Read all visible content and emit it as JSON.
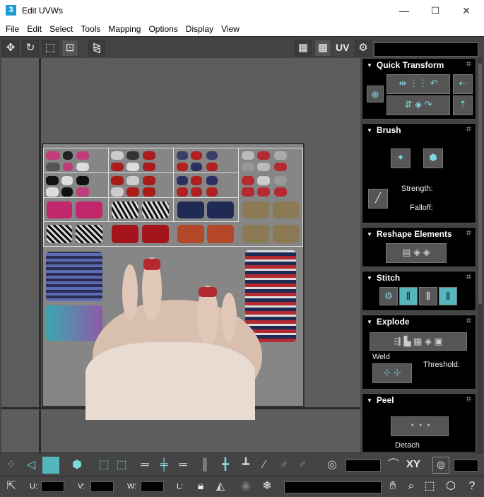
{
  "window": {
    "app_icon": "3",
    "title": "Edit UVWs",
    "minimize": "—",
    "maximize": "☐",
    "close": "✕"
  },
  "menu": [
    "File",
    "Edit",
    "Select",
    "Tools",
    "Mapping",
    "Options",
    "Display",
    "View"
  ],
  "toolbar": {
    "uv_label": "UV"
  },
  "panel": {
    "quick_transform": {
      "title": "Quick Transform"
    },
    "brush": {
      "title": "Brush",
      "strength_label": "Strength:",
      "falloff_label": "Falloff:"
    },
    "reshape": {
      "title": "Reshape Elements"
    },
    "stitch": {
      "title": "Stitch"
    },
    "explode": {
      "title": "Explode",
      "weld_label": "Weld",
      "threshold_label": "Threshold:"
    },
    "peel": {
      "title": "Peel",
      "detach_label": "Detach"
    }
  },
  "bottom": {
    "xy_label": "XY",
    "u_label": "U:",
    "v_label": "V:",
    "w_label": "W:",
    "l_label": "L:"
  },
  "colors": {
    "accent_teal": "#55b7be",
    "panel_bg": "#000000",
    "toolbar_bg": "#444444",
    "viewport_bg": "#5d5d5d"
  }
}
